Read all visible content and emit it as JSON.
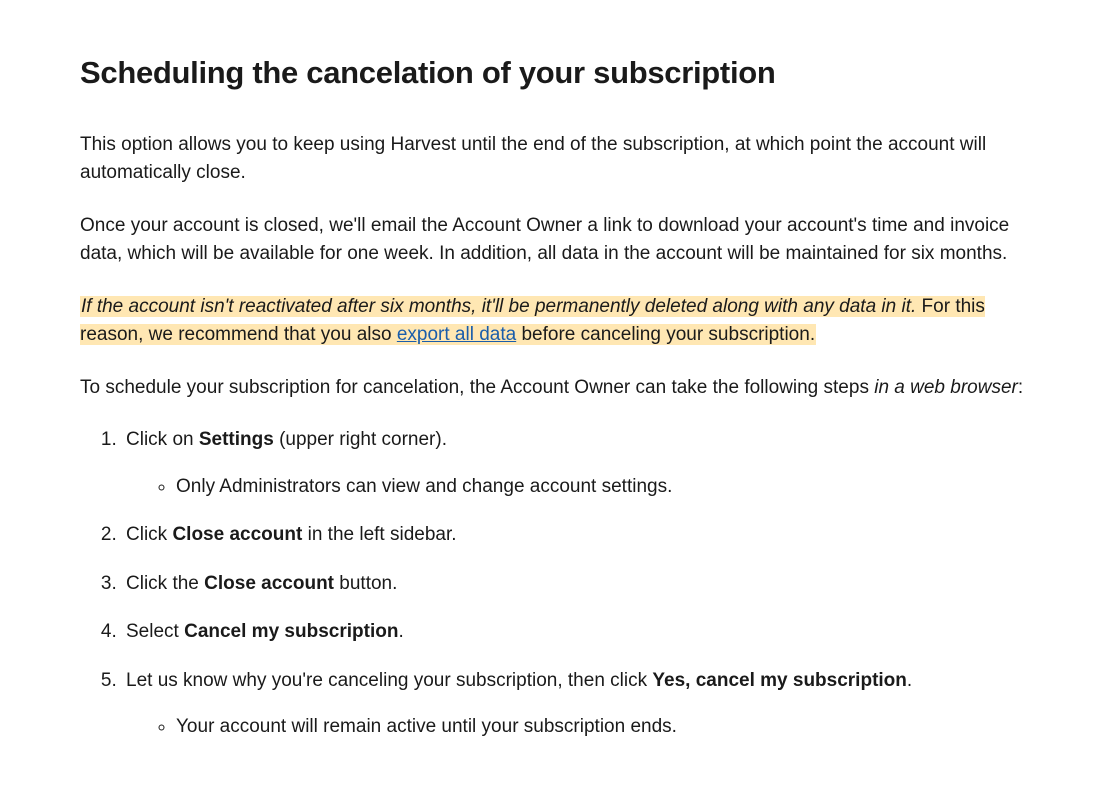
{
  "heading": "Scheduling the cancelation of your subscription",
  "para1": "This option allows you to keep using Harvest until the end of the subscription, at which point the account will automatically close.",
  "para2": "Once your account is closed, we'll email the Account Owner a link to download your account's time and invoice data, which will be available for one week. In addition, all data in the account will be maintained for six months.",
  "para3": {
    "hl_italic": "If the account isn't reactivated after six months, it'll be permanently deleted along with any data in it.",
    "hl_pre_link": " For this reason, we recommend that you also ",
    "link": "export all data",
    "hl_post_link": " before canceling your subscription."
  },
  "para4": {
    "pre": "To schedule your subscription for cancelation, the Account Owner can take the following steps ",
    "em": "in a web browser",
    "post": ":"
  },
  "steps": {
    "s1": {
      "pre": "Click on ",
      "b": "Settings",
      "post": " (upper right corner).",
      "sub": "Only Administrators can view and change account settings."
    },
    "s2": {
      "pre": "Click ",
      "b": "Close account",
      "post": " in the left sidebar."
    },
    "s3": {
      "pre": "Click the ",
      "b": "Close account",
      "post": " button."
    },
    "s4": {
      "pre": "Select ",
      "b": "Cancel my subscription",
      "post": "."
    },
    "s5": {
      "pre": "Let us know why you're canceling your subscription, then click ",
      "b": "Yes, cancel my subscription",
      "post": ".",
      "sub": "Your account will remain active until your subscription ends."
    }
  }
}
